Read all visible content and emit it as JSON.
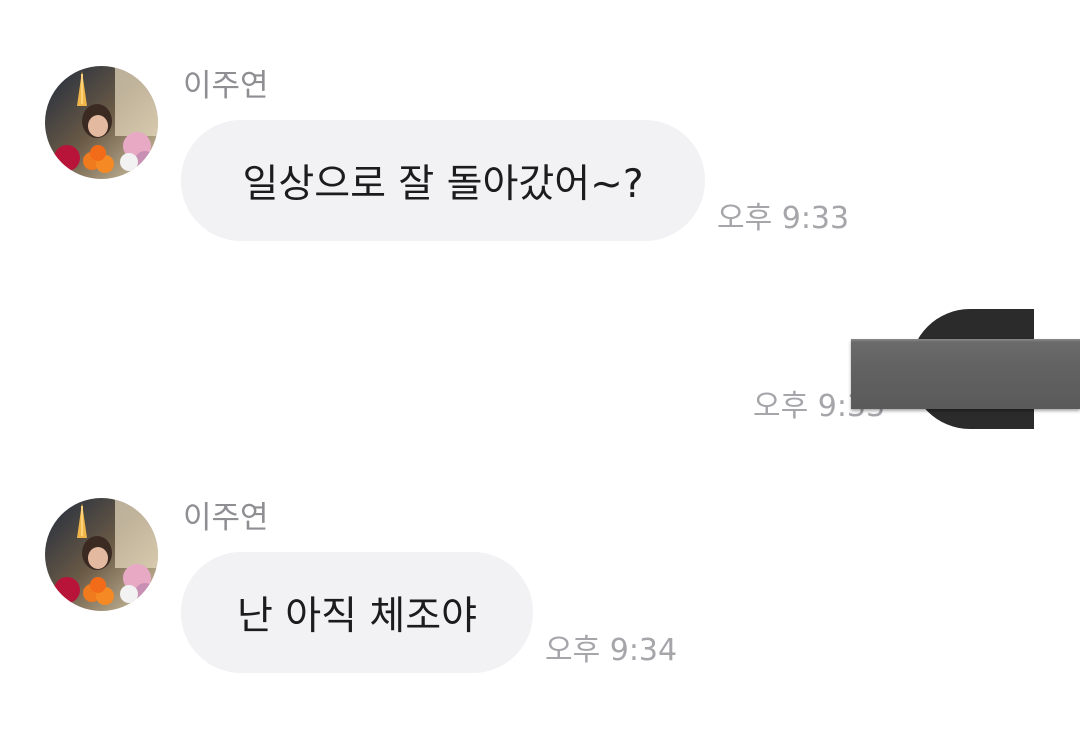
{
  "messages": [
    {
      "sender": "이주연",
      "text": "일상으로 잘 돌아갔어~?",
      "time": "오후 9:33"
    },
    {
      "outgoing": true,
      "time": "오후 9:33",
      "content_redacted": true
    },
    {
      "sender": "이주연",
      "text": "난 아직 체조야",
      "time": "오후 9:34"
    }
  ],
  "colors": {
    "bubble_bg": "#f2f2f4",
    "text": "#1c1c1e",
    "meta": "#a5a5aa",
    "redaction": "#5f5f5f"
  },
  "icons": {
    "avatar": "profile-photo"
  }
}
